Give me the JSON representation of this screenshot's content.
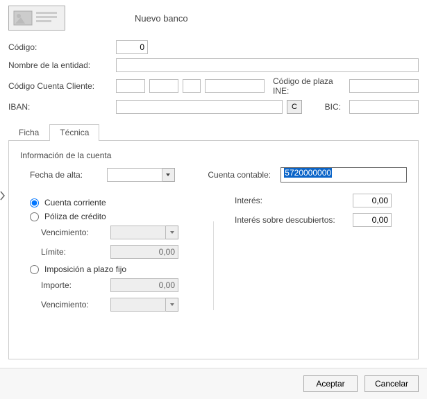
{
  "header": {
    "title": "Nuevo banco"
  },
  "form": {
    "codigo_label": "Código:",
    "codigo_value": "0",
    "nombre_label": "Nombre de la entidad:",
    "nombre_value": "",
    "ccc_label": "Código Cuenta Cliente:",
    "ccc_a": "",
    "ccc_b": "",
    "ccc_c": "",
    "ccc_d": "",
    "plaza_label": "Código de plaza INE:",
    "plaza_value": "",
    "iban_label": "IBAN:",
    "iban_value": "",
    "c_button": "C",
    "bic_label": "BIC:",
    "bic_value": ""
  },
  "tabs": {
    "ficha": "Ficha",
    "tecnica": "Técnica"
  },
  "tecnica": {
    "section": "Información de la cuenta",
    "fecha_label": "Fecha de alta:",
    "fecha_value": "",
    "cuenta_label": "Cuenta contable:",
    "cuenta_value": "5720000000",
    "radio_corriente": "Cuenta corriente",
    "radio_poliza": "Póliza de crédito",
    "venc_label": "Vencimiento:",
    "venc_value": "",
    "limite_label": "Límite:",
    "limite_value": "0,00",
    "radio_plazo": "Imposición a plazo fijo",
    "importe_label": "Importe:",
    "importe_value": "0,00",
    "venc2_label": "Vencimiento:",
    "venc2_value": "",
    "interes_label": "Interés:",
    "interes_value": "0,00",
    "interes_desc_label": "Interés sobre descubiertos:",
    "interes_desc_value": "0,00"
  },
  "footer": {
    "aceptar": "Aceptar",
    "cancelar": "Cancelar"
  }
}
